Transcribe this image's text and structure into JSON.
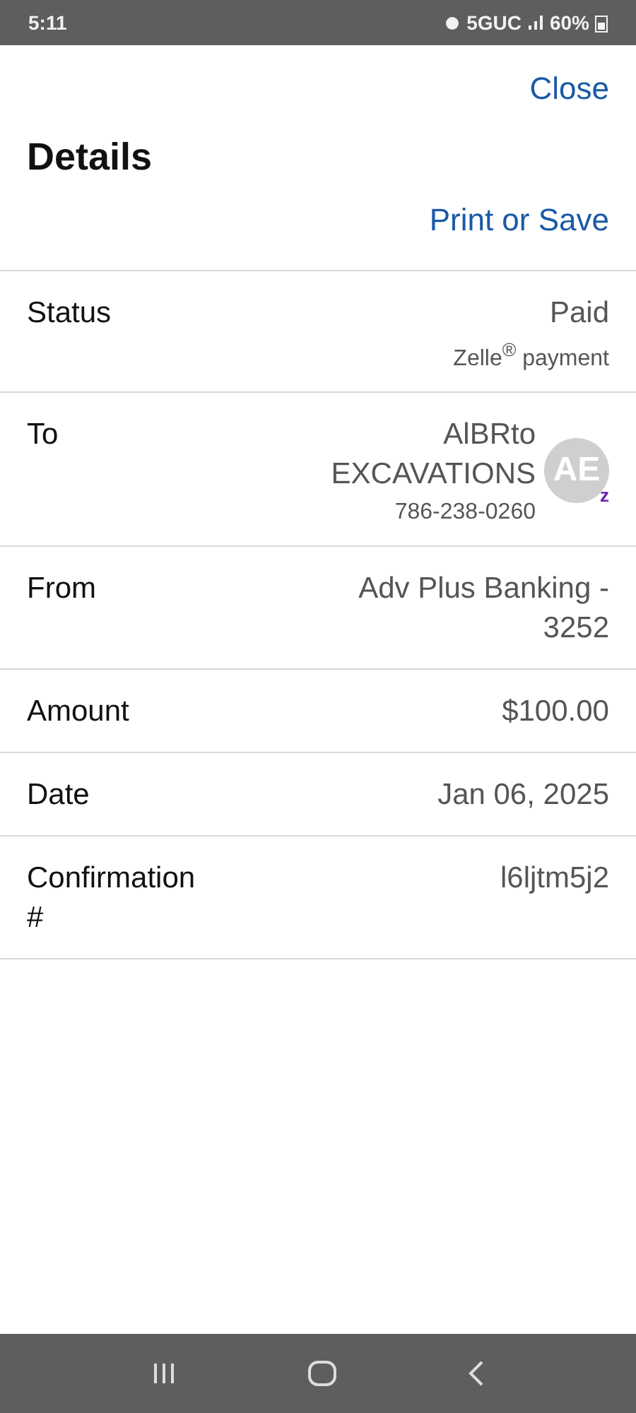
{
  "status_bar": {
    "time": "5:11",
    "network": "5GUC",
    "battery": "60%"
  },
  "header": {
    "close": "Close",
    "title": "Details",
    "print": "Print or Save"
  },
  "rows": [
    {
      "label": "Status",
      "value": "Paid",
      "sub": "Zelle$^{®}$ payment"
    },
    {
      "label": "To",
      "value": "AlBRto EXCAVATIONS",
      "sub": "786-238-0260",
      "avatar": {
        "initials": "AE",
        "badge": "z"
      }
    },
    {
      "label": "From",
      "value": "Adv Plus Banking - 3252"
    },
    {
      "label": "Amount",
      "value": "$100.00"
    },
    {
      "label": "Date",
      "value": "Jan 06, 2025"
    },
    {
      "label": "Confirmation #",
      "value": "l6ljtm5j2"
    }
  ]
}
